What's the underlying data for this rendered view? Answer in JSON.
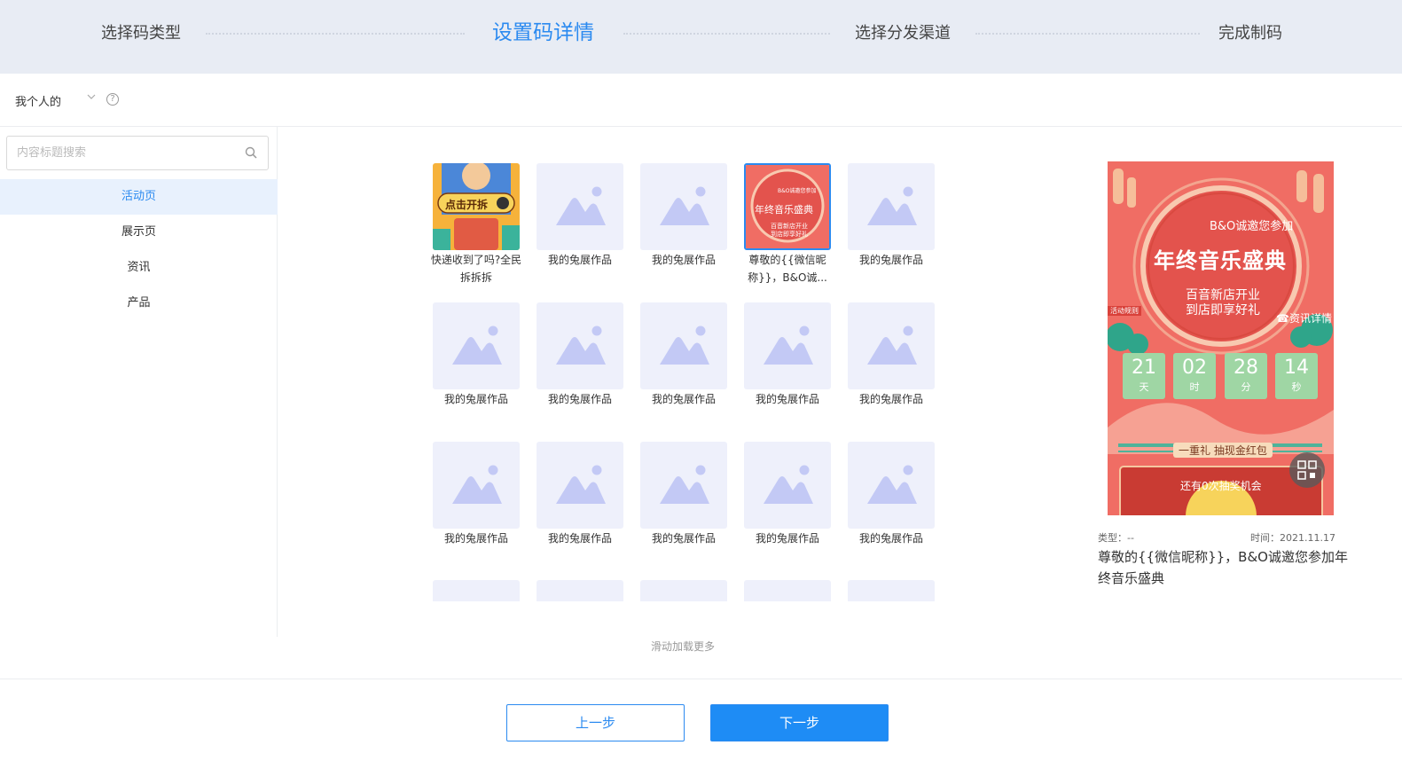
{
  "steps": [
    {
      "label": "选择码类型"
    },
    {
      "label": "设置码详情"
    },
    {
      "label": "选择分发渠道"
    },
    {
      "label": "完成制码"
    }
  ],
  "scope": {
    "label": "我个人的",
    "help": "?"
  },
  "search": {
    "placeholder": "内容标题搜索"
  },
  "categories": [
    "活动页",
    "展示页",
    "资讯",
    "产品"
  ],
  "grid": {
    "items": [
      {
        "caption": "快递收到了吗?全民拆拆拆",
        "kind": "promo",
        "badge": "点击开拆"
      },
      {
        "caption": "我的兔展作品",
        "kind": "placeholder"
      },
      {
        "caption": "我的兔展作品",
        "kind": "placeholder"
      },
      {
        "caption": "尊敬的{{微信昵称}}，B&O诚...",
        "kind": "music",
        "selected": true
      },
      {
        "caption": "我的兔展作品",
        "kind": "placeholder"
      },
      {
        "caption": "我的兔展作品",
        "kind": "placeholder"
      },
      {
        "caption": "我的兔展作品",
        "kind": "placeholder"
      },
      {
        "caption": "我的兔展作品",
        "kind": "placeholder"
      },
      {
        "caption": "我的兔展作品",
        "kind": "placeholder"
      },
      {
        "caption": "我的兔展作品",
        "kind": "placeholder"
      },
      {
        "caption": "我的兔展作品",
        "kind": "placeholder"
      },
      {
        "caption": "我的兔展作品",
        "kind": "placeholder"
      },
      {
        "caption": "我的兔展作品",
        "kind": "placeholder"
      },
      {
        "caption": "我的兔展作品",
        "kind": "placeholder"
      },
      {
        "caption": "我的兔展作品",
        "kind": "placeholder"
      }
    ],
    "load_more": "滑动加载更多"
  },
  "thumb_music": {
    "line1": "B&O诚邀您参加",
    "line2": "年终音乐盛典",
    "line3": "百音新店开业",
    "line4": "到店即享好礼"
  },
  "preview": {
    "invite": "B&O诚邀您参加",
    "title": "年终音乐盛典",
    "subtitle1": "百音新店开业",
    "subtitle2": "到店即享好礼",
    "rules": "活动规则",
    "info_button": "资讯详情",
    "countdown": [
      {
        "num": "21",
        "unit": "天"
      },
      {
        "num": "02",
        "unit": "时"
      },
      {
        "num": "28",
        "unit": "分"
      },
      {
        "num": "14",
        "unit": "秒"
      }
    ],
    "prize": "一重礼 抽现金红包",
    "chances": "还有0次抽奖机会",
    "type_label": "类型：--",
    "time_label": "时间：2021.11.17",
    "full_title": "尊敬的{{微信昵称}}，B&O诚邀您参加年终音乐盛典"
  },
  "footer": {
    "prev": "上一步",
    "next": "下一步"
  },
  "colors": {
    "accent": "#2b8af0",
    "header_bg": "#e8ecf4",
    "placeholder_bg": "#eef0fb",
    "placeholder_icon": "#c3c9f5",
    "poster_red": "#f06d64"
  }
}
